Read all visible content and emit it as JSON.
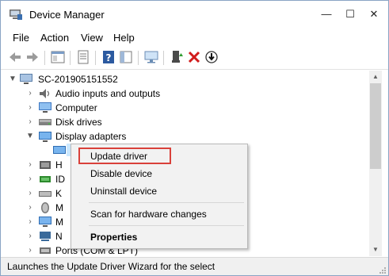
{
  "window": {
    "title": "Device Manager"
  },
  "title_buttons": {
    "minimize": "—",
    "maximize": "☐",
    "close": "✕"
  },
  "menu": [
    "File",
    "Action",
    "View",
    "Help"
  ],
  "tree": {
    "root": "SC-201905151552",
    "items": [
      {
        "label": "Audio inputs and outputs",
        "icon": "speaker-icon"
      },
      {
        "label": "Computer",
        "icon": "computer-icon"
      },
      {
        "label": "Disk drives",
        "icon": "disk-drive-icon"
      },
      {
        "label": "Display adapters",
        "icon": "display-adapter-icon"
      }
    ],
    "hidden_rows": [
      "H",
      "ID",
      "K",
      "M",
      "M",
      "N",
      "Ports (COM & LPT)"
    ]
  },
  "context_menu": {
    "items": [
      "Update driver",
      "Disable device",
      "Uninstall device"
    ],
    "scan": "Scan for hardware changes",
    "properties": "Properties",
    "highlight_color": "#d9413a"
  },
  "status_bar": {
    "text": "Launches the Update Driver Wizard for the select"
  }
}
